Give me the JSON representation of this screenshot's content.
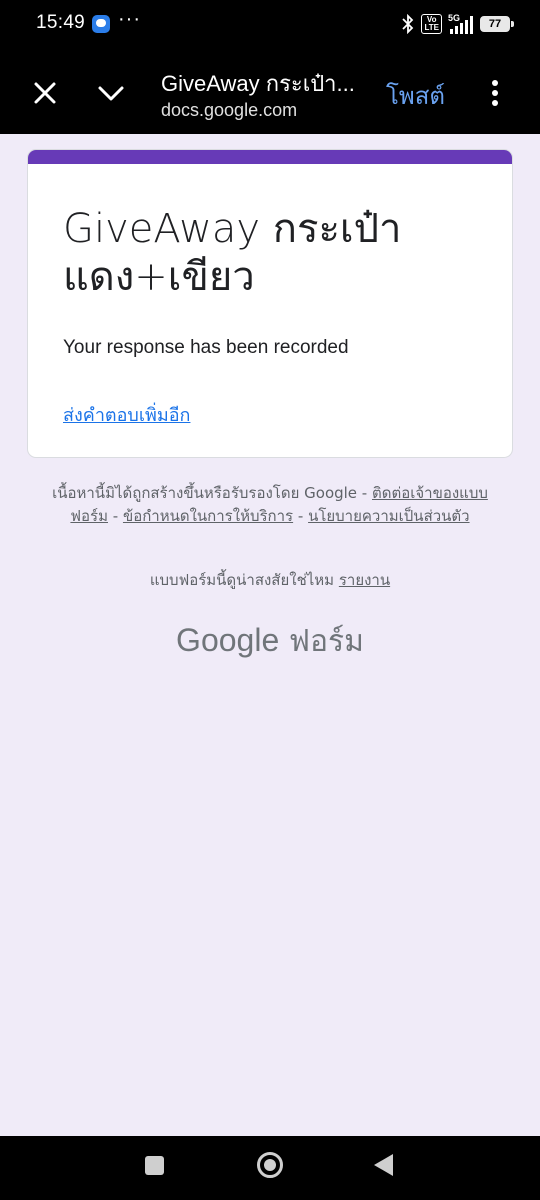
{
  "status_bar": {
    "time": "15:49",
    "icons": [
      "messages-icon",
      "more-dots",
      "bluetooth-icon",
      "volte-icon",
      "signal-5g-icon"
    ],
    "volte_label": "Vo\nLTE",
    "network": "5G",
    "battery": "77"
  },
  "app_bar": {
    "title": "GiveAway กระเป๋า...",
    "url": "docs.google.com",
    "post_label": "โพสต์",
    "icons": [
      "close-icon",
      "chevron-down-icon",
      "more-vert-icon"
    ]
  },
  "form": {
    "accent_color": "#673ab7",
    "title": "GiveAway กระเป๋าแดง+เขียว",
    "message": "Your response has been recorded",
    "another_response_link": "ส่งคำตอบเพิ่มอีก"
  },
  "footer": {
    "disclaimer": "เนื้อหานี้มิได้ถูกสร้างขึ้นหรือรับรองโดย Google - ",
    "contact_owner": "ติดต่อเจ้าของแบบฟอร์ม",
    "sep": " - ",
    "terms": "ข้อกำหนดในการให้บริการ",
    "privacy": "นโยบายความเป็นส่วนตัว",
    "suspicious": "แบบฟอร์มนี้ดูน่าสงสัยใช่ไหม ",
    "report": "รายงาน",
    "brand_google": "Google",
    "brand_forms": "ฟอร์ม"
  },
  "nav_bar": {
    "buttons": [
      "recents-button",
      "home-button",
      "back-button"
    ]
  },
  "colors": {
    "background": "#f0ebf8",
    "link": "#1a73e8",
    "post": "#6aa2f0"
  }
}
